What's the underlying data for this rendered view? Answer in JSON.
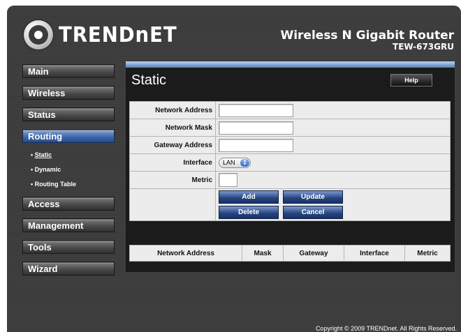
{
  "header": {
    "logo_text": "TRENDnET",
    "product_title": "Wireless N Gigabit Router",
    "model": "TEW-673GRU"
  },
  "nav": {
    "items": [
      "Main",
      "Wireless",
      "Status",
      "Routing",
      "Access",
      "Management",
      "Tools",
      "Wizard"
    ],
    "active": "Routing",
    "routing_sub": [
      "• Static",
      "• Dynamic",
      "• Routing Table"
    ],
    "current_sub": "Static"
  },
  "panel": {
    "title": "Static",
    "help_label": "Help",
    "fields": {
      "network_address_label": "Network Address",
      "network_mask_label": "Network Mask",
      "gateway_address_label": "Gateway Address",
      "interface_label": "Interface",
      "interface_value": "LAN",
      "metric_label": "Metric",
      "network_address_value": "",
      "network_mask_value": "",
      "gateway_address_value": "",
      "metric_value": ""
    },
    "buttons": {
      "add": "Add",
      "update": "Update",
      "delete": "Delete",
      "cancel": "Cancel"
    },
    "table_headers": [
      "Network Address",
      "Mask",
      "Gateway",
      "Interface",
      "Metric"
    ]
  },
  "footer": {
    "copyright": "Copyright © 2009 TRENDnet. All Rights Reserved."
  },
  "colors": {
    "background": "#3b3b3b",
    "panel": "#1b1b1b",
    "accent_blue": "#3a64a7",
    "form_cell": "#ececec"
  }
}
